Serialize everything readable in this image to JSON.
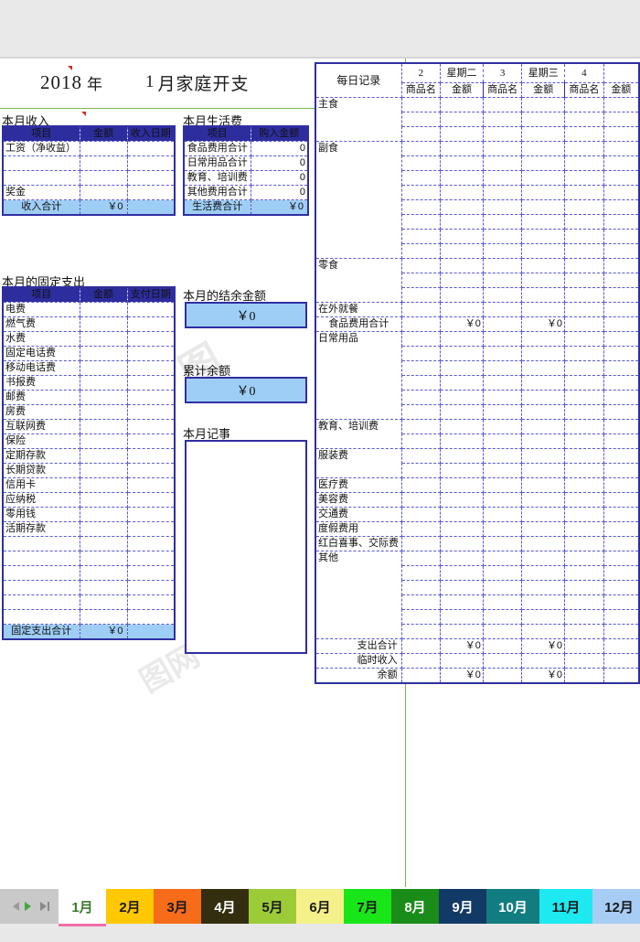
{
  "title": {
    "year": "2018",
    "year_label": "年",
    "month": "1",
    "month_label": "月家庭开支"
  },
  "income": {
    "heading": "本月收入",
    "columns": [
      "项目",
      "金额",
      "收入日期"
    ],
    "rows": [
      {
        "item": "工资（净收益）",
        "amount": "",
        "date": ""
      },
      {
        "item": "",
        "amount": "",
        "date": ""
      },
      {
        "item": "",
        "amount": "",
        "date": ""
      },
      {
        "item": "奖金",
        "amount": "",
        "date": ""
      }
    ],
    "total_label": "收入合计",
    "total_value": "￥0"
  },
  "living": {
    "heading": "本月生活费",
    "columns": [
      "项目",
      "购入金额"
    ],
    "rows": [
      {
        "item": "食品费用合计",
        "amount": "0"
      },
      {
        "item": "日常用品合计",
        "amount": "0"
      },
      {
        "item": "教育、培训费",
        "amount": "0"
      },
      {
        "item": "其他费用合计",
        "amount": "0"
      }
    ],
    "total_label": "生活费合计",
    "total_value": "￥0"
  },
  "fixed": {
    "heading": "本月的固定支出",
    "columns": [
      "项目",
      "金额",
      "支付日期"
    ],
    "items": [
      "电费",
      "燃气费",
      "水费",
      "固定电话费",
      "移动电话费",
      "书报费",
      "邮费",
      "房费",
      "互联网费",
      "保险",
      "定期存款",
      "长期贷款",
      "信用卡",
      "应纳税",
      "零用钱",
      "活期存款",
      "",
      "",
      "",
      "",
      "",
      ""
    ],
    "total_label": "固定支出合计",
    "total_value": "￥0"
  },
  "balance": {
    "month_label": "本月的结余金额",
    "month_value": "￥0",
    "cumulative_label": "累计余额",
    "cumulative_value": "￥0",
    "notes_label": "本月记事",
    "notes_value": ""
  },
  "daily": {
    "corner_label": "每日记录",
    "sub_columns": [
      "商品名",
      "金额"
    ],
    "days": [
      {
        "num": "2",
        "weekday": "星期二"
      },
      {
        "num": "3",
        "weekday": "星期三"
      },
      {
        "num": "4",
        "weekday": ""
      }
    ],
    "groups": [
      {
        "label": "主食",
        "rows": 3
      },
      {
        "label": "副食",
        "rows": 8
      },
      {
        "label": "零食",
        "rows": 3
      },
      {
        "label": "在外就餐",
        "rows": 1
      }
    ],
    "food_total_label": "食品费用合计",
    "food_total_values": [
      "￥0",
      "￥0"
    ],
    "groups2": [
      {
        "label": "日常用品",
        "rows": 6
      },
      {
        "label": "教育、培训费",
        "rows": 2
      },
      {
        "label": "服装费",
        "rows": 2
      },
      {
        "label": "医疗费",
        "rows": 1
      },
      {
        "label": "美容费",
        "rows": 1
      },
      {
        "label": "交通费",
        "rows": 1
      },
      {
        "label": "度假费用",
        "rows": 1
      },
      {
        "label": "红白喜事、交际费",
        "rows": 1
      },
      {
        "label": "其他",
        "rows": 6
      }
    ],
    "summary": [
      {
        "label": "支出合计",
        "values": [
          "￥0",
          "￥0"
        ]
      },
      {
        "label": "临时收入",
        "values": [
          "",
          ""
        ]
      },
      {
        "label": "余额",
        "values": [
          "￥0",
          "￥0"
        ]
      }
    ]
  },
  "sheet_tabs": [
    {
      "label": "1月",
      "bg": "#ffffff",
      "fg": "#3a7a29",
      "active": true
    },
    {
      "label": "2月",
      "bg": "#ffc800",
      "fg": "#1a1a1a",
      "active": false
    },
    {
      "label": "3月",
      "bg": "#f76c18",
      "fg": "#1a1a1a",
      "active": false
    },
    {
      "label": "4月",
      "bg": "#332e10",
      "fg": "#ffffff",
      "active": false
    },
    {
      "label": "5月",
      "bg": "#9ccb38",
      "fg": "#1a1a1a",
      "active": false
    },
    {
      "label": "6月",
      "bg": "#f5f18a",
      "fg": "#1a1a1a",
      "active": false
    },
    {
      "label": "7月",
      "bg": "#19e619",
      "fg": "#1a1a1a",
      "active": false
    },
    {
      "label": "8月",
      "bg": "#1a8c1a",
      "fg": "#ffffff",
      "active": false
    },
    {
      "label": "9月",
      "bg": "#123a66",
      "fg": "#ffffff",
      "active": false
    },
    {
      "label": "10月",
      "bg": "#127d80",
      "fg": "#ffffff",
      "active": false
    },
    {
      "label": "11月",
      "bg": "#1ee8f0",
      "fg": "#1a1a1a",
      "active": false
    },
    {
      "label": "12月",
      "bg": "#a8cdf4",
      "fg": "#1a1a1a",
      "active": false
    }
  ],
  "nav": {
    "prev": "prev-sheet-icon",
    "next": "next-sheet-icon",
    "last": "last-sheet-icon"
  },
  "watermark": "6图网"
}
